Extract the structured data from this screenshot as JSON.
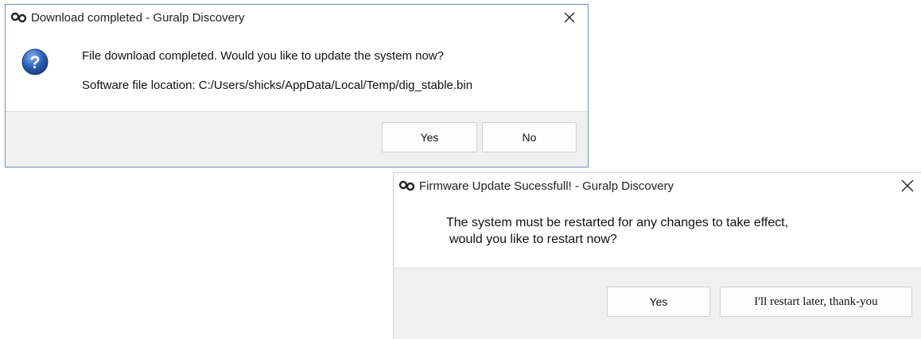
{
  "dialog1": {
    "title": "Download completed - Guralp Discovery",
    "message_line1": "File download completed. Would you like to update the system now?",
    "message_line2": "Software file location: C:/Users/shicks/AppData/Local/Temp/dig_stable.bin",
    "yes_label": "Yes",
    "no_label": "No",
    "close_glyph": "✕"
  },
  "dialog2": {
    "title": "Firmware Update Sucessfull! - Guralp Discovery",
    "message_line1": "The system must be restarted for any changes to take effect,",
    "message_line2": "would you like to restart now?",
    "yes_label": "Yes",
    "later_label": "I'll restart later, thank-you",
    "close_glyph": "✕"
  },
  "icons": {
    "app": "app-icon",
    "question": "question-icon",
    "close": "close-icon"
  },
  "colors": {
    "question_icon": "#2b5fb3",
    "frame_border": "#6f8fbf",
    "footer_bg": "#f0f0f0"
  }
}
